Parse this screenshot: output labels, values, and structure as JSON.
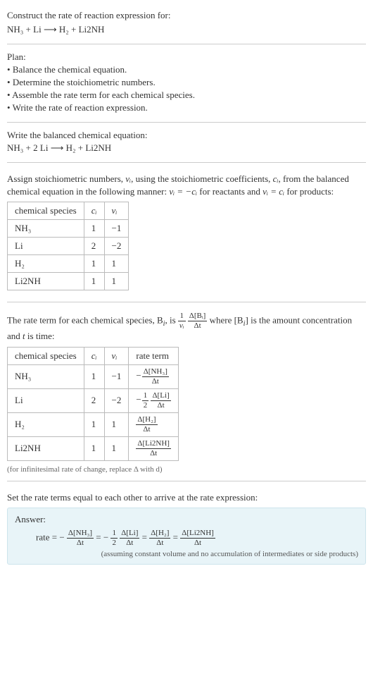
{
  "header": {
    "prompt": "Construct the rate of reaction expression for:",
    "equation": "NH₃ + Li ⟶ H₂ + Li2NH"
  },
  "plan": {
    "label": "Plan:",
    "items": [
      "Balance the chemical equation.",
      "Determine the stoichiometric numbers.",
      "Assemble the rate term for each chemical species.",
      "Write the rate of reaction expression."
    ]
  },
  "balanced": {
    "label": "Write the balanced chemical equation:",
    "equation": "NH₃ + 2 Li ⟶ H₂ + Li2NH"
  },
  "stoich": {
    "intro_a": "Assign stoichiometric numbers, ",
    "intro_b": ", using the stoichiometric coefficients, ",
    "intro_c": ", from the balanced chemical equation in the following manner: ",
    "intro_d": " for reactants and ",
    "intro_e": " for products:",
    "nu_i": "νᵢ",
    "c_i": "cᵢ",
    "rel_react": "νᵢ = −cᵢ",
    "rel_prod": "νᵢ = cᵢ",
    "headers": {
      "species": "chemical species",
      "ci": "cᵢ",
      "nui": "νᵢ"
    },
    "rows": [
      {
        "species": "NH₃",
        "ci": "1",
        "nui": "−1"
      },
      {
        "species": "Li",
        "ci": "2",
        "nui": "−2"
      },
      {
        "species": "H₂",
        "ci": "1",
        "nui": "1"
      },
      {
        "species": "Li2NH",
        "ci": "1",
        "nui": "1"
      }
    ]
  },
  "rateterm": {
    "intro_a": "The rate term for each chemical species, B",
    "intro_b": ", is ",
    "intro_c": " where [B",
    "intro_d": "] is the amount concentration and ",
    "intro_e": " is time:",
    "t_var": "t",
    "frac1": {
      "num": "1",
      "den": "νᵢ"
    },
    "frac2": {
      "num": "Δ[Bᵢ]",
      "den": "Δt"
    },
    "headers": {
      "species": "chemical species",
      "ci": "cᵢ",
      "nui": "νᵢ",
      "rate": "rate term"
    },
    "rows": [
      {
        "species": "NH₃",
        "ci": "1",
        "nui": "−1",
        "rate_neg": "−",
        "rate_half": "",
        "rate_num": "Δ[NH₃]",
        "rate_den": "Δt"
      },
      {
        "species": "Li",
        "ci": "2",
        "nui": "−2",
        "rate_neg": "−",
        "rate_half_num": "1",
        "rate_half_den": "2",
        "rate_num": "Δ[Li]",
        "rate_den": "Δt"
      },
      {
        "species": "H₂",
        "ci": "1",
        "nui": "1",
        "rate_neg": "",
        "rate_half": "",
        "rate_num": "Δ[H₂]",
        "rate_den": "Δt"
      },
      {
        "species": "Li2NH",
        "ci": "1",
        "nui": "1",
        "rate_neg": "",
        "rate_half": "",
        "rate_num": "Δ[Li2NH]",
        "rate_den": "Δt"
      }
    ],
    "note": "(for infinitesimal rate of change, replace Δ with d)"
  },
  "final": {
    "intro": "Set the rate terms equal to each other to arrive at the rate expression:",
    "answer_label": "Answer:",
    "eq_prefix": "rate = −",
    "t1": {
      "num": "Δ[NH₃]",
      "den": "Δt"
    },
    "eq_mid1": " = −",
    "half": {
      "num": "1",
      "den": "2"
    },
    "t2": {
      "num": "Δ[Li]",
      "den": "Δt"
    },
    "eq_mid2": " = ",
    "t3": {
      "num": "Δ[H₂]",
      "den": "Δt"
    },
    "eq_mid3": " = ",
    "t4": {
      "num": "Δ[Li2NH]",
      "den": "Δt"
    },
    "note": "(assuming constant volume and no accumulation of intermediates or side products)"
  }
}
